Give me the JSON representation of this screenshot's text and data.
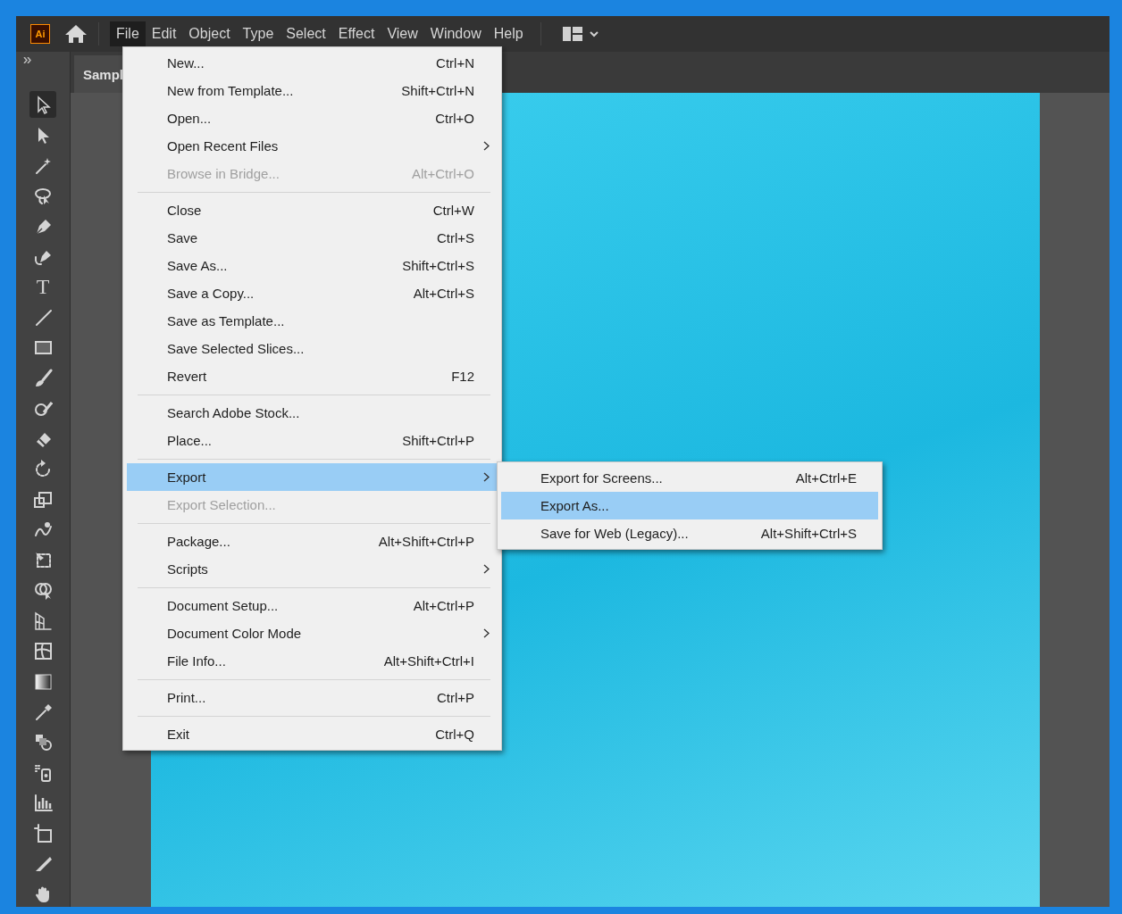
{
  "app_bar": {
    "logo": "Ai",
    "menus": [
      {
        "label": "File",
        "selected": true
      },
      {
        "label": "Edit",
        "selected": false
      },
      {
        "label": "Object",
        "selected": false
      },
      {
        "label": "Type",
        "selected": false
      },
      {
        "label": "Select",
        "selected": false
      },
      {
        "label": "Effect",
        "selected": false
      },
      {
        "label": "View",
        "selected": false
      },
      {
        "label": "Window",
        "selected": false
      },
      {
        "label": "Help",
        "selected": false
      }
    ]
  },
  "document_tab": {
    "label": "Sampl"
  },
  "toolbar": {
    "type_tool_glyph": "T"
  },
  "file_menu": {
    "groups": [
      [
        {
          "label": "New...",
          "shortcut": "Ctrl+N",
          "submenu": false,
          "disabled": false,
          "selected": false
        },
        {
          "label": "New from Template...",
          "shortcut": "Shift+Ctrl+N",
          "submenu": false,
          "disabled": false,
          "selected": false
        },
        {
          "label": "Open...",
          "shortcut": "Ctrl+O",
          "submenu": false,
          "disabled": false,
          "selected": false
        },
        {
          "label": "Open Recent Files",
          "submenu": true,
          "disabled": false,
          "selected": false
        },
        {
          "label": "Browse in Bridge...",
          "shortcut": "Alt+Ctrl+O",
          "submenu": false,
          "disabled": true,
          "selected": false
        }
      ],
      [
        {
          "label": "Close",
          "shortcut": "Ctrl+W",
          "submenu": false,
          "disabled": false,
          "selected": false
        },
        {
          "label": "Save",
          "shortcut": "Ctrl+S",
          "submenu": false,
          "disabled": false,
          "selected": false
        },
        {
          "label": "Save As...",
          "shortcut": "Shift+Ctrl+S",
          "submenu": false,
          "disabled": false,
          "selected": false
        },
        {
          "label": "Save a Copy...",
          "shortcut": "Alt+Ctrl+S",
          "submenu": false,
          "disabled": false,
          "selected": false
        },
        {
          "label": "Save as Template...",
          "submenu": false,
          "disabled": false,
          "selected": false
        },
        {
          "label": "Save Selected Slices...",
          "submenu": false,
          "disabled": false,
          "selected": false
        },
        {
          "label": "Revert",
          "shortcut": "F12",
          "submenu": false,
          "disabled": false,
          "selected": false
        }
      ],
      [
        {
          "label": "Search Adobe Stock...",
          "submenu": false,
          "disabled": false,
          "selected": false
        },
        {
          "label": "Place...",
          "shortcut": "Shift+Ctrl+P",
          "submenu": false,
          "disabled": false,
          "selected": false
        }
      ],
      [
        {
          "label": "Export",
          "submenu": true,
          "disabled": false,
          "selected": true
        },
        {
          "label": "Export Selection...",
          "submenu": false,
          "disabled": true,
          "selected": false
        }
      ],
      [
        {
          "label": "Package...",
          "shortcut": "Alt+Shift+Ctrl+P",
          "submenu": false,
          "disabled": false,
          "selected": false
        },
        {
          "label": "Scripts",
          "submenu": true,
          "disabled": false,
          "selected": false
        }
      ],
      [
        {
          "label": "Document Setup...",
          "shortcut": "Alt+Ctrl+P",
          "submenu": false,
          "disabled": false,
          "selected": false
        },
        {
          "label": "Document Color Mode",
          "submenu": true,
          "disabled": false,
          "selected": false
        },
        {
          "label": "File Info...",
          "shortcut": "Alt+Shift+Ctrl+I",
          "submenu": false,
          "disabled": false,
          "selected": false
        }
      ],
      [
        {
          "label": "Print...",
          "shortcut": "Ctrl+P",
          "submenu": false,
          "disabled": false,
          "selected": false
        }
      ],
      [
        {
          "label": "Exit",
          "shortcut": "Ctrl+Q",
          "submenu": false,
          "disabled": false,
          "selected": false
        }
      ]
    ]
  },
  "export_submenu": {
    "items": [
      {
        "label": "Export for Screens...",
        "shortcut": "Alt+Ctrl+E",
        "submenu": false,
        "disabled": false,
        "selected": false
      },
      {
        "label": "Export As...",
        "submenu": false,
        "disabled": false,
        "selected": true
      },
      {
        "label": "Save for Web (Legacy)...",
        "shortcut": "Alt+Shift+Ctrl+S",
        "submenu": false,
        "disabled": false,
        "selected": false
      }
    ]
  }
}
